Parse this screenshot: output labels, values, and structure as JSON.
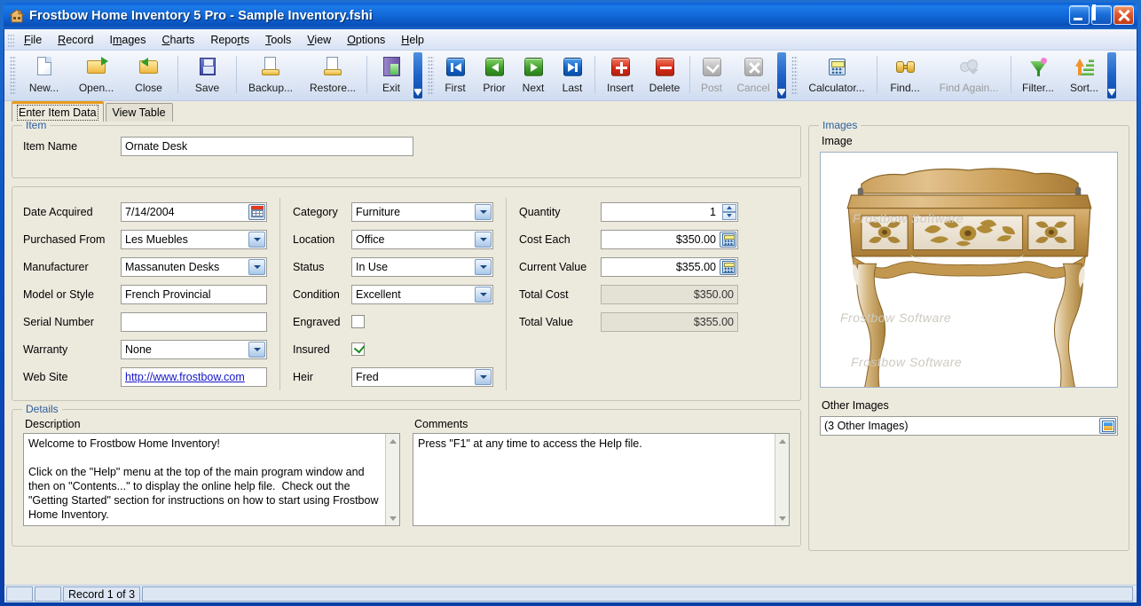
{
  "window": {
    "title": "Frostbow Home Inventory 5 Pro - Sample Inventory.fshi",
    "app_icon": "house-icon",
    "buttons": {
      "minimize": "minimize-icon",
      "maximize": "maximize-icon",
      "close": "close-icon"
    }
  },
  "menu": [
    {
      "label": "File",
      "mnemonic": "F"
    },
    {
      "label": "Record",
      "mnemonic": "R"
    },
    {
      "label": "Images",
      "mnemonic": "m"
    },
    {
      "label": "Charts",
      "mnemonic": "C"
    },
    {
      "label": "Reports",
      "mnemonic": "R"
    },
    {
      "label": "Tools",
      "mnemonic": "T"
    },
    {
      "label": "View",
      "mnemonic": "V"
    },
    {
      "label": "Options",
      "mnemonic": "O"
    },
    {
      "label": "Help",
      "mnemonic": "H"
    }
  ],
  "toolbar": {
    "groups": [
      {
        "buttons": [
          {
            "label": "New...",
            "icon": "new-page-icon",
            "enabled": true
          },
          {
            "label": "Open...",
            "icon": "open-folder-icon",
            "enabled": true
          },
          {
            "label": "Close",
            "icon": "close-folder-icon",
            "enabled": true
          },
          {
            "label": "Save",
            "icon": "floppy-disk-icon",
            "enabled": true,
            "sep_before": true
          },
          {
            "label": "Backup...",
            "icon": "backup-icon",
            "enabled": true,
            "sep_before": true
          },
          {
            "label": "Restore...",
            "icon": "restore-icon",
            "enabled": true
          },
          {
            "label": "Exit",
            "icon": "exit-door-icon",
            "enabled": true,
            "sep_before": true
          }
        ]
      },
      {
        "buttons": [
          {
            "label": "First",
            "icon": "first-record-icon",
            "enabled": true
          },
          {
            "label": "Prior",
            "icon": "prior-record-icon",
            "enabled": true
          },
          {
            "label": "Next",
            "icon": "next-record-icon",
            "enabled": true
          },
          {
            "label": "Last",
            "icon": "last-record-icon",
            "enabled": true
          },
          {
            "label": "Insert",
            "icon": "insert-record-icon",
            "enabled": true,
            "sep_before": true
          },
          {
            "label": "Delete",
            "icon": "delete-record-icon",
            "enabled": true
          },
          {
            "label": "Post",
            "icon": "post-check-icon",
            "enabled": false,
            "sep_before": true
          },
          {
            "label": "Cancel",
            "icon": "cancel-x-icon",
            "enabled": false
          }
        ]
      },
      {
        "buttons": [
          {
            "label": "Calculator...",
            "icon": "calculator-icon",
            "enabled": true
          },
          {
            "label": "Find...",
            "icon": "binoculars-icon",
            "enabled": true,
            "sep_before": true
          },
          {
            "label": "Find Again...",
            "icon": "find-again-icon",
            "enabled": false
          },
          {
            "label": "Filter...",
            "icon": "funnel-icon",
            "enabled": true,
            "sep_before": true
          },
          {
            "label": "Sort...",
            "icon": "sort-ascending-icon",
            "enabled": true
          }
        ]
      }
    ]
  },
  "tabs": [
    {
      "label": "Enter Item Data",
      "active": true
    },
    {
      "label": "View Table",
      "active": false
    }
  ],
  "item_group": {
    "legend": "Item",
    "item_name_label": "Item Name",
    "item_name_value": "Ornate Desk"
  },
  "fields_group": {
    "left": [
      {
        "label": "Date Acquired",
        "value": "7/14/2004",
        "type": "date"
      },
      {
        "label": "Purchased From",
        "value": "Les Muebles",
        "type": "combo"
      },
      {
        "label": "Manufacturer",
        "value": "Massanuten Desks",
        "type": "combo"
      },
      {
        "label": "Model or Style",
        "value": "French Provincial",
        "type": "text"
      },
      {
        "label": "Serial Number",
        "value": "",
        "type": "text"
      },
      {
        "label": "Warranty",
        "value": "None",
        "type": "combo"
      },
      {
        "label": "Web Site",
        "value": "http://www.frostbow.com",
        "type": "link"
      }
    ],
    "middle": [
      {
        "label": "Category",
        "value": "Furniture",
        "type": "combo"
      },
      {
        "label": "Location",
        "value": "Office",
        "type": "combo"
      },
      {
        "label": "Status",
        "value": "In Use",
        "type": "combo"
      },
      {
        "label": "Condition",
        "value": "Excellent",
        "type": "combo"
      },
      {
        "label": "Engraved",
        "value": "",
        "type": "checkbox",
        "checked": false
      },
      {
        "label": "Insured",
        "value": "",
        "type": "checkbox",
        "checked": true
      },
      {
        "label": "Heir",
        "value": "Fred",
        "type": "combo"
      }
    ],
    "right": [
      {
        "label": "Quantity",
        "value": "1",
        "type": "spin"
      },
      {
        "label": "Cost Each",
        "value": "$350.00",
        "type": "currency"
      },
      {
        "label": "Current Value",
        "value": "$355.00",
        "type": "currency"
      },
      {
        "label": "Total Cost",
        "value": "$350.00",
        "type": "readonly"
      },
      {
        "label": "Total Value",
        "value": "$355.00",
        "type": "readonly"
      }
    ]
  },
  "details_group": {
    "legend": "Details",
    "description_label": "Description",
    "description_value": "Welcome to Frostbow Home Inventory!\n\nClick on the \"Help\" menu at the top of the main program window and then on \"Contents...\" to display the online help file.  Check out the \"Getting Started\" section for instructions on how to start using Frostbow Home Inventory.",
    "comments_label": "Comments",
    "comments_value": "Press \"F1\" at any time to access the Help file."
  },
  "images_group": {
    "legend": "Images",
    "image_label": "Image",
    "image_alt": "ornate-desk-photo",
    "watermark": "Frostbow Software",
    "other_images_label": "Other Images",
    "other_images_value": "(3 Other Images)",
    "other_images_button": "pick-image-icon"
  },
  "statusbar": {
    "panel1": "",
    "panel2": "",
    "record_text": "Record 1 of 3",
    "panel4": ""
  },
  "colors": {
    "title_blue": "#1168d8",
    "panel_beige": "#ece9dd",
    "legend_blue": "#2b5f9e",
    "active_tab_accent": "#e89a1c",
    "link_blue": "#1515c8",
    "check_green": "#1e8a1e"
  }
}
